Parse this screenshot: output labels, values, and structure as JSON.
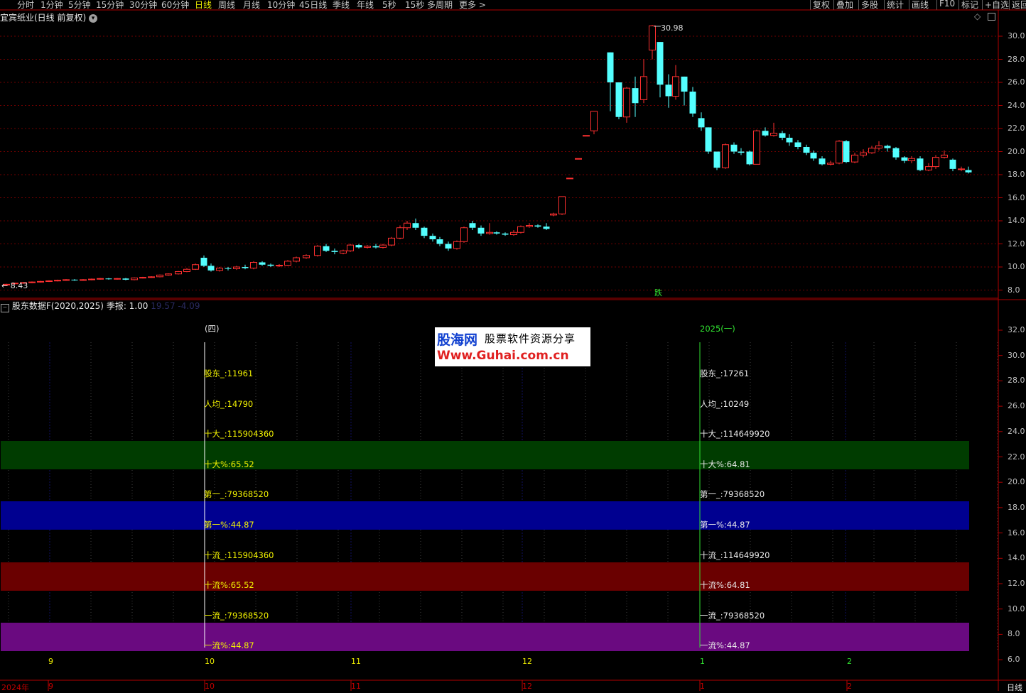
{
  "toolbar": {
    "items": [
      "分时",
      "1分钟",
      "5分钟",
      "15分钟",
      "30分钟",
      "60分钟",
      "日线",
      "周线",
      "月线",
      "10分钟",
      "45日线",
      "季线",
      "年线",
      "5秒",
      "15秒",
      "多周期",
      "更多 >"
    ],
    "active_index": 6,
    "right_items": [
      "复权",
      "叠加",
      "多股",
      "统计",
      "画线",
      "F10",
      "标记",
      "+自选",
      "返回"
    ]
  },
  "main_panel": {
    "title": "宜宾纸业(日线 前复权)",
    "high_label": "30.98",
    "low_label": "← 8.43",
    "marker": "跌",
    "y_ticks": [
      "30.0",
      "28.0",
      "26.0",
      "24.0",
      "22.0",
      "20.0",
      "18.0",
      "16.0",
      "14.0",
      "12.0",
      "10.0",
      "8.0"
    ]
  },
  "sub_panel": {
    "title": "股东数据F(2020,2025)",
    "param": "季报: 1.00",
    "faded": "19.57  -4.09",
    "y_ticks": [
      "32.0",
      "30.0",
      "28.0",
      "26.0",
      "24.0",
      "22.0",
      "20.0",
      "18.0",
      "16.0",
      "14.0",
      "12.0",
      "10.0",
      "8.0",
      "6.0"
    ],
    "q4_header": "(四)",
    "q1_header": "2025(一)",
    "q4_labels": [
      "股东_:11961",
      "人均_:14790",
      "十大_:115904360",
      "十大%:65.52",
      "第一_:79368520",
      "第一%:44.87",
      "十流_:115904360",
      "十流%:65.52",
      "一流_:79368520",
      "一流%:44.87"
    ],
    "q1_labels": [
      "股东_:17261",
      "人均_:10249",
      "十大_:114649920",
      "十大%:64.81",
      "第一_:79368520",
      "第一%:44.87",
      "十流_:114649920",
      "十流%:64.81",
      "一流_:79368520",
      "一流%:44.87"
    ]
  },
  "x_axis": {
    "labels": [
      "9",
      "10",
      "11",
      "12",
      "1",
      "2"
    ],
    "bottom_labels": [
      "2024年",
      "9",
      "10",
      "11",
      "12",
      "1",
      "2"
    ],
    "period": "日线"
  },
  "watermark": {
    "brand": "股海网",
    "slogan": "股票软件资源分享",
    "url": "Www.Guhai.com.cn"
  },
  "colors": {
    "up": "#ff3030",
    "down": "#54ffff",
    "green_band": "#003c00",
    "blue_band": "#000090",
    "red_band": "#6a0000",
    "purple_band": "#6a0a80"
  }
}
